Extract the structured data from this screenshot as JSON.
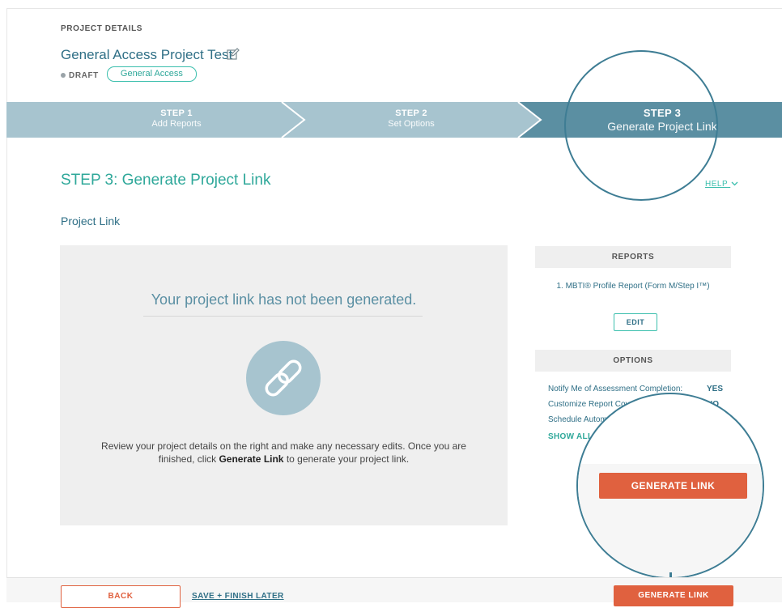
{
  "project": {
    "kicker": "PROJECT DETAILS",
    "title": "General Access Project Test",
    "status": "DRAFT",
    "access_type": "General Access"
  },
  "stepper": {
    "steps": [
      {
        "number": "STEP 1",
        "label": "Add Reports"
      },
      {
        "number": "STEP 2",
        "label": "Set Options"
      },
      {
        "number": "STEP 3",
        "label": "Generate Project Link"
      }
    ],
    "active_step": 3
  },
  "main": {
    "title": "STEP 3: Generate Project Link",
    "help_label": "HELP",
    "subtitle": "Project Link",
    "not_generated_message": "Your project link has not been generated.",
    "instructions_before": "Review your project details on the right and make any necessary edits. Once you are finished, click ",
    "instructions_bold": "Generate Link",
    "instructions_after": " to generate your project link."
  },
  "sidebar": {
    "reports_header": "REPORTS",
    "reports": [
      "1. MBTI® Profile Report (Form M/Step I™)"
    ],
    "edit_label": "EDIT",
    "options_header": "OPTIONS",
    "options": [
      {
        "label": "Notify Me of Assessment Completion:",
        "value": "YES"
      },
      {
        "label": "Customize Report Cove",
        "value": "NO"
      },
      {
        "label": "Schedule Autom",
        "value": ""
      }
    ],
    "show_all_label": "SHOW ALL"
  },
  "callout": {
    "generate_label": "GENERATE LINK"
  },
  "footer": {
    "back_label": "BACK",
    "save_later_label": "SAVE + FINISH LATER",
    "generate_label": "GENERATE LINK"
  },
  "colors": {
    "accent_teal": "#2fa89a",
    "title_blue": "#2f6f86",
    "stepper_light": "#a7c4cf",
    "stepper_active": "#5b8fa2",
    "action_orange": "#e0613f"
  }
}
